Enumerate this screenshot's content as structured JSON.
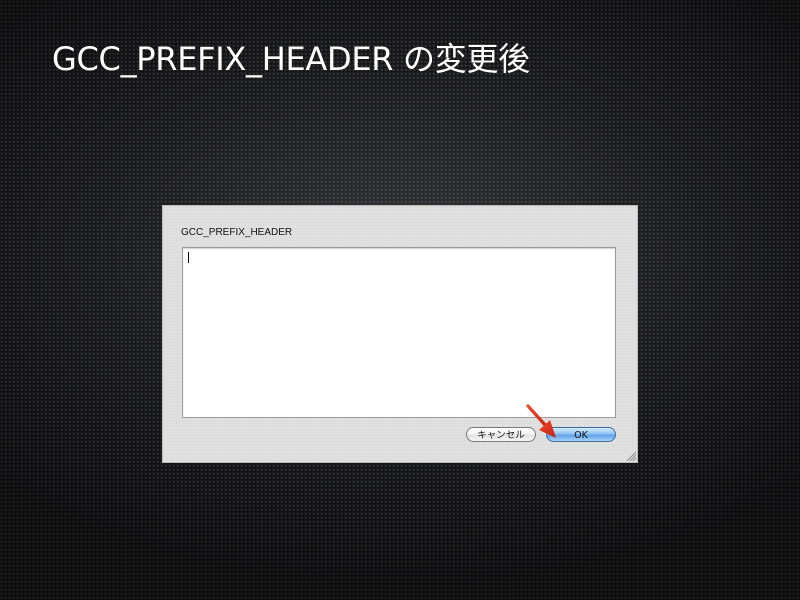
{
  "slide": {
    "title": "GCC_PREFIX_HEADER の変更後"
  },
  "dialog": {
    "field_label": "GCC_PREFIX_HEADER",
    "field_value": "",
    "cancel_label": "キャンセル",
    "ok_label": "OK"
  },
  "icons": {
    "pointer": "red-arrow-icon",
    "resize": "resize-grip-icon"
  },
  "colors": {
    "arrow": "#e8321e",
    "default_button": "#6aaaf0"
  }
}
